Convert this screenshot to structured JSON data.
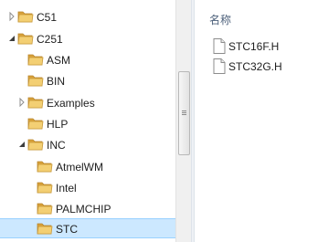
{
  "tree": {
    "items": [
      {
        "label": "C51",
        "expander": "collapsed"
      },
      {
        "label": "C251",
        "expander": "expanded"
      },
      {
        "label": "ASM",
        "expander": "none"
      },
      {
        "label": "BIN",
        "expander": "none"
      },
      {
        "label": "Examples",
        "expander": "collapsed"
      },
      {
        "label": "HLP",
        "expander": "none"
      },
      {
        "label": "INC",
        "expander": "expanded"
      },
      {
        "label": "AtmelWM",
        "expander": "none"
      },
      {
        "label": "Intel",
        "expander": "none"
      },
      {
        "label": "PALMCHIP",
        "expander": "none"
      },
      {
        "label": "STC",
        "expander": "none",
        "selected": true
      }
    ]
  },
  "file_list": {
    "column_header": "名称",
    "files": [
      {
        "name": "STC16F.H"
      },
      {
        "name": "STC32G.H"
      }
    ]
  },
  "colors": {
    "selection": "#cce8ff",
    "folder": "#e8b64a",
    "header_text": "#4c607a"
  },
  "icons": {
    "folder": "folder-icon",
    "file": "document-icon",
    "expand": "chevron-right-icon",
    "collapse": "triangle-down-icon"
  }
}
